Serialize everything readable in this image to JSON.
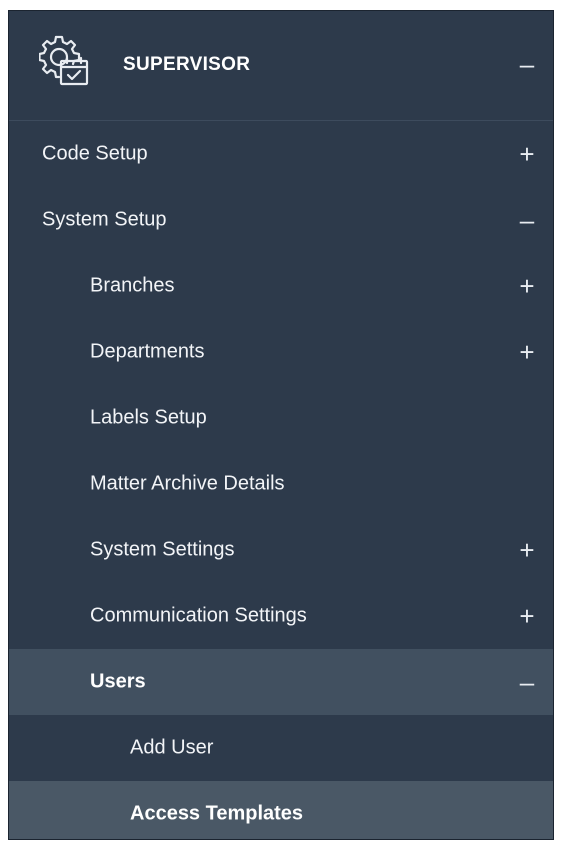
{
  "header": {
    "title": "SUPERVISOR",
    "toggle": "–",
    "icon": "settings-calendar-icon"
  },
  "menu": {
    "code_setup": {
      "label": "Code Setup",
      "toggle": "+"
    },
    "system_setup": {
      "label": "System Setup",
      "toggle": "–"
    },
    "branches": {
      "label": "Branches",
      "toggle": "+"
    },
    "departments": {
      "label": "Departments",
      "toggle": "+"
    },
    "labels_setup": {
      "label": "Labels Setup"
    },
    "matter_archive_details": {
      "label": "Matter Archive Details"
    },
    "system_settings": {
      "label": "System Settings",
      "toggle": "+"
    },
    "communication_settings": {
      "label": "Communication Settings",
      "toggle": "+"
    },
    "users": {
      "label": "Users",
      "toggle": "–"
    },
    "add_user": {
      "label": "Add User"
    },
    "access_templates": {
      "label": "Access Templates"
    }
  },
  "colors": {
    "panel_bg": "#2d3a4b",
    "active_bg": "#415060",
    "selected_bg": "#4a5866",
    "text": "#f2f4f7"
  }
}
